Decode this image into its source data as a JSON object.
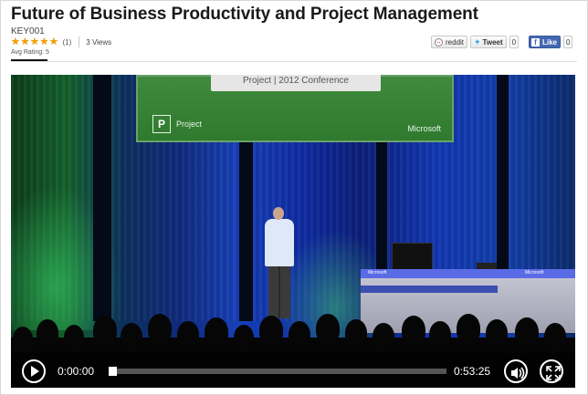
{
  "video_page": {
    "title": "Future of Business Productivity and Project Management",
    "code": "KEY001",
    "rating": {
      "stars": 5,
      "max_stars": 5,
      "count_label": "(1)",
      "avg_label": "Avg Rating: 5"
    },
    "views_label": "3 Views"
  },
  "share": {
    "reddit_label": "reddit",
    "tweet_label": "Tweet",
    "tweet_count": "0",
    "like_label": "Like",
    "like_count": "0"
  },
  "video_frame": {
    "screen_banner": "Project | 2012 Conference",
    "screen_product": "Project",
    "screen_brand": "Microsoft",
    "podium_brand_left": "Microsoft",
    "podium_brand_right": "Microsoft"
  },
  "player": {
    "current_time": "0:00:00",
    "duration": "0:53:25",
    "progress_fraction": 0.0
  },
  "colors": {
    "facebook_blue": "#4267b2",
    "twitter_blue": "#2aa3ef",
    "star_gold": "#f5a300"
  }
}
